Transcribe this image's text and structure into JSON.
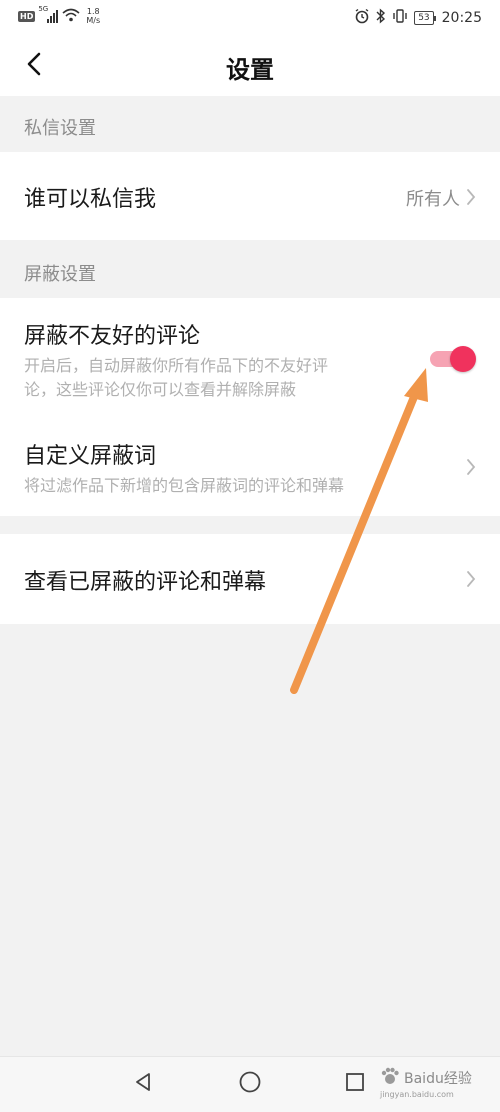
{
  "status_bar": {
    "hd_label": "HD",
    "signal_label": "5G",
    "net_speed_value": "1.8",
    "net_speed_unit": "M/s",
    "battery_level": "53",
    "time": "20:25"
  },
  "header": {
    "title": "设置"
  },
  "sections": {
    "messages": {
      "label": "私信设置",
      "who_can_message_title": "谁可以私信我",
      "who_can_message_value": "所有人"
    },
    "blocking": {
      "label": "屏蔽设置",
      "block_unfriendly_title": "屏蔽不友好的评论",
      "block_unfriendly_desc_line1": "开启后，自动屏蔽你所有作品下的不友好评",
      "block_unfriendly_desc_line2": "论，这些评论仅你可以查看并解除屏蔽",
      "block_unfriendly_enabled": true,
      "custom_words_title": "自定义屏蔽词",
      "custom_words_desc": "将过滤作品下新增的包含屏蔽词的评论和弹幕"
    },
    "view_blocked": {
      "title": "查看已屏蔽的评论和弹幕"
    }
  },
  "watermark": {
    "brand": "Baidu经验",
    "url": "jingyan.baidu.com"
  },
  "colors": {
    "accent": "#f0325d",
    "accent_track": "#f6a3b3",
    "annotation_arrow": "#f0964a",
    "page_background": "#f2f2f2"
  }
}
